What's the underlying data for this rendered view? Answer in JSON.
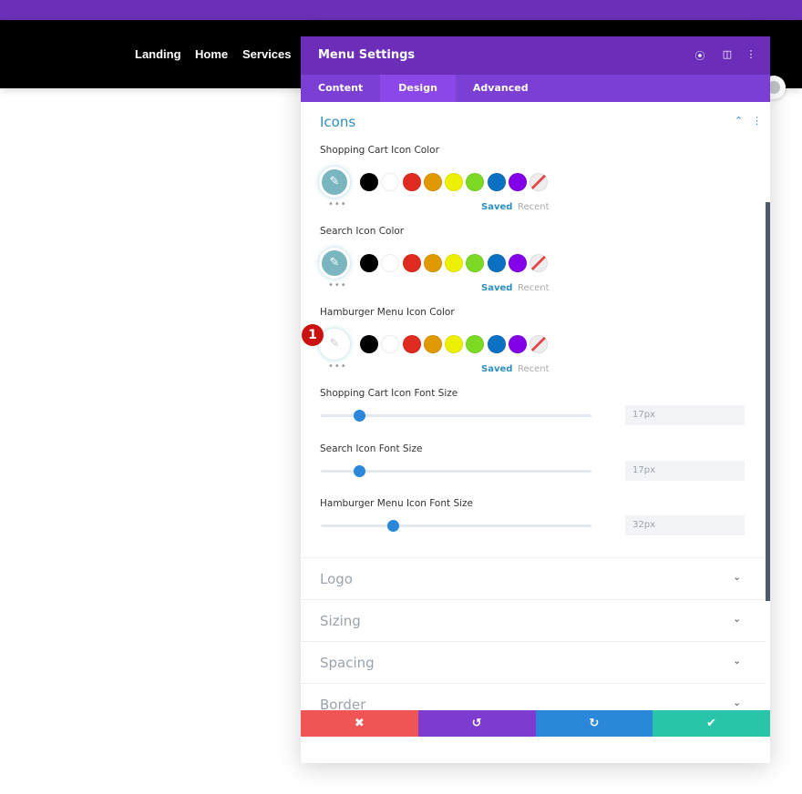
{
  "site": {
    "nav": [
      "Landing",
      "Home",
      "Services"
    ]
  },
  "modal": {
    "title": "Menu Settings",
    "header_icons": [
      "focus-icon",
      "split-view-icon",
      "more-vertical-icon"
    ],
    "tabs": [
      "Content",
      "Design",
      "Advanced"
    ],
    "active_tab": "Design",
    "section": "Icons",
    "colors": {
      "swatches": [
        "#000000",
        "#ffffff",
        "#e02b20",
        "#e09900",
        "#edf000",
        "#7cda24",
        "#0c71c3",
        "#8300e9"
      ],
      "accent": "#2c8fbf"
    },
    "color_fields": [
      {
        "label": "Shopping Cart Icon Color",
        "saved": "Saved",
        "recent": "Recent",
        "has_value": true
      },
      {
        "label": "Search Icon Color",
        "saved": "Saved",
        "recent": "Recent",
        "has_value": true
      },
      {
        "label": "Hamburger Menu Icon Color",
        "saved": "Saved",
        "recent": "Recent",
        "has_value": false,
        "badge": "1"
      }
    ],
    "sliders": [
      {
        "label": "Shopping Cart Icon Font Size",
        "value": "17px",
        "num": 17
      },
      {
        "label": "Search Icon Font Size",
        "value": "17px",
        "num": 17
      },
      {
        "label": "Hamburger Menu Icon Font Size",
        "value": "32px",
        "num": 32
      }
    ],
    "collapsed": [
      "Logo",
      "Sizing",
      "Spacing",
      "Border"
    ],
    "footer": {
      "buttons": [
        {
          "name": "cancel",
          "icon": "close-icon",
          "glyph": "✖",
          "color": "#ef5555"
        },
        {
          "name": "undo",
          "icon": "undo-icon",
          "glyph": "↺",
          "color": "#7e3bd0"
        },
        {
          "name": "redo",
          "icon": "redo-icon",
          "glyph": "↻",
          "color": "#2b87da"
        },
        {
          "name": "save",
          "icon": "check-icon",
          "glyph": "✔",
          "color": "#29c4a9"
        }
      ]
    }
  }
}
